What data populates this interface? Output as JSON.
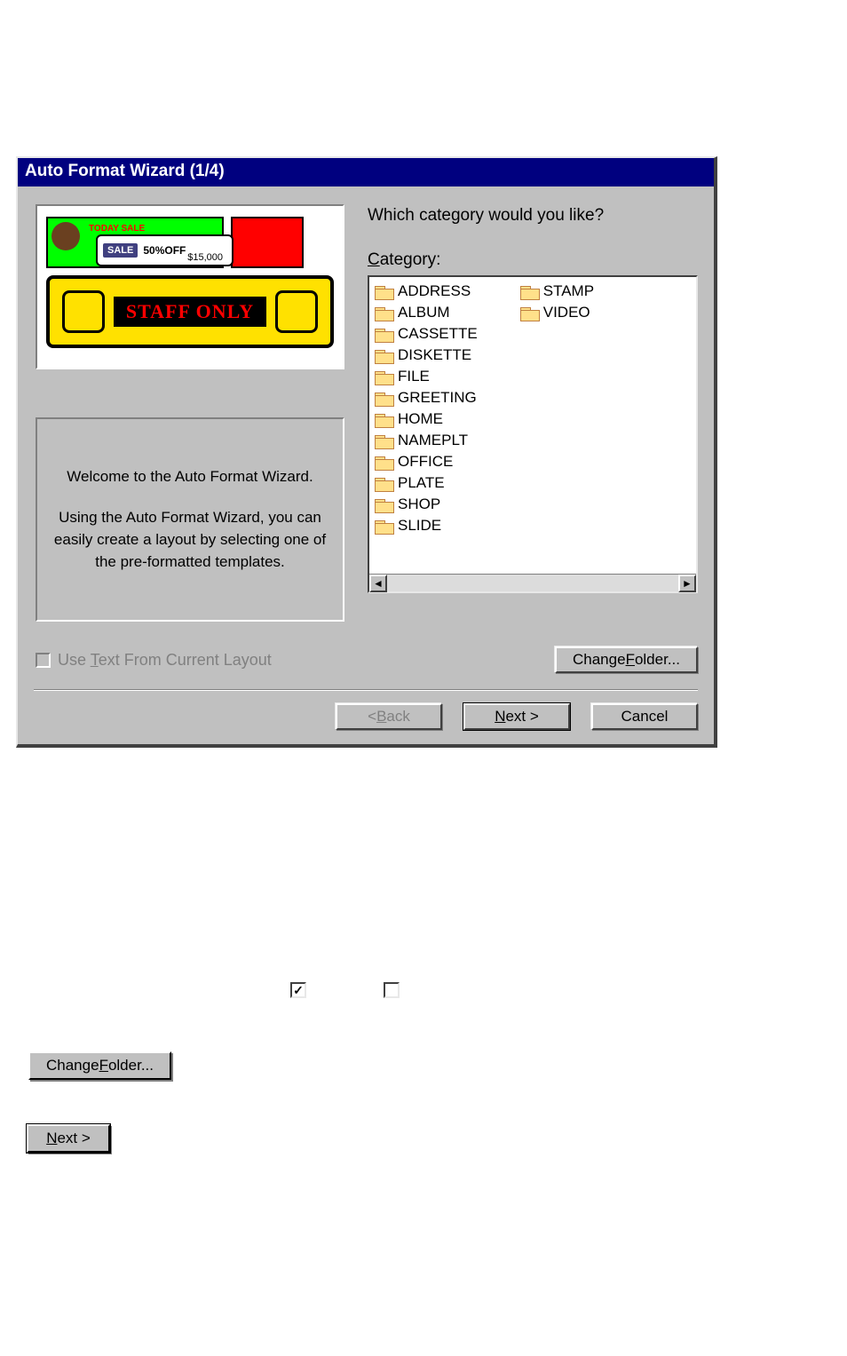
{
  "dialog": {
    "title": "Auto Format Wizard (1/4)",
    "preview": {
      "sale_pill": "SALE",
      "sale_off": "50%OFF",
      "sale_price": "$15,000",
      "staff": "STAFF ONLY"
    },
    "welcome_line1": "Welcome to the Auto Format Wizard.",
    "welcome_line2": "Using the Auto Format Wizard, you can easily create a layout by selecting one of the pre-formatted templates.",
    "prompt": "Which category would you like?",
    "category_label_pre": "C",
    "category_label_post": "ategory:",
    "categories_col1": [
      "ADDRESS",
      "ALBUM",
      "CASSETTE",
      "DISKETTE",
      "FILE",
      "GREETING",
      "HOME",
      "NAMEPLT",
      "OFFICE",
      "PLATE",
      "SHOP",
      "SLIDE"
    ],
    "categories_col2": [
      "STAMP",
      "VIDEO"
    ],
    "use_text_pre": "Use ",
    "use_text_ul": "T",
    "use_text_post": "ext From Current Layout",
    "change_folder_pre": "Change ",
    "change_folder_ul": "F",
    "change_folder_post": "older...",
    "back_pre": "< ",
    "back_ul": "B",
    "back_post": "ack",
    "next_ul": "N",
    "next_post": "ext >",
    "cancel": "Cancel"
  },
  "floating": {
    "change_folder_pre": "Change ",
    "change_folder_ul": "F",
    "change_folder_post": "older...",
    "next_ul": "N",
    "next_post": "ext >"
  }
}
